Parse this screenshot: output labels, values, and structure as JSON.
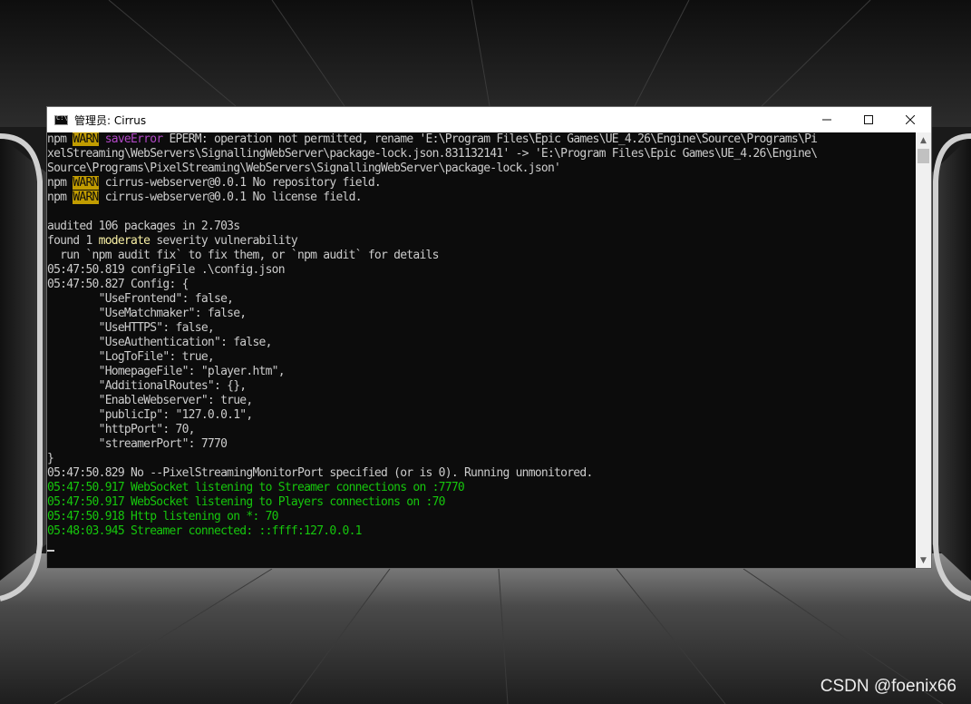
{
  "window": {
    "title": "管理员: Cirrus",
    "icon": "cmd-icon",
    "controls": [
      "minimize-icon",
      "maximize-icon",
      "close-icon"
    ]
  },
  "console": {
    "lines": [
      [
        {
          "t": "npm "
        },
        {
          "t": "WARN",
          "c": "warn"
        },
        {
          "t": " "
        },
        {
          "t": "saveError",
          "c": "purple"
        },
        {
          "t": " EPERM: operation not permitted, rename 'E:\\Program Files\\Epic Games\\UE_4.26\\Engine\\Source\\Programs\\Pi"
        }
      ],
      [
        {
          "t": "xelStreaming\\WebServers\\SignallingWebServer\\package-lock.json.831132141' -> 'E:\\Program Files\\Epic Games\\UE_4.26\\Engine\\"
        }
      ],
      [
        {
          "t": "Source\\Programs\\PixelStreaming\\WebServers\\SignallingWebServer\\package-lock.json'"
        }
      ],
      [
        {
          "t": "npm "
        },
        {
          "t": "WARN",
          "c": "warn"
        },
        {
          "t": " cirrus-webserver@0.0.1 No repository field."
        }
      ],
      [
        {
          "t": "npm "
        },
        {
          "t": "WARN",
          "c": "warn"
        },
        {
          "t": " cirrus-webserver@0.0.1 No license field."
        }
      ],
      [
        {
          "t": ""
        }
      ],
      [
        {
          "t": "audited 106 packages in 2.703s"
        }
      ],
      [
        {
          "t": "found 1 "
        },
        {
          "t": "moderate",
          "c": "yellow"
        },
        {
          "t": " severity vulnerability"
        }
      ],
      [
        {
          "t": "  run `npm audit fix` to fix them, or `npm audit` for details"
        }
      ],
      [
        {
          "t": "05:47:50.819 configFile .\\config.json"
        }
      ],
      [
        {
          "t": "05:47:50.827 Config: {"
        }
      ],
      [
        {
          "t": "        \"UseFrontend\": false,"
        }
      ],
      [
        {
          "t": "        \"UseMatchmaker\": false,"
        }
      ],
      [
        {
          "t": "        \"UseHTTPS\": false,"
        }
      ],
      [
        {
          "t": "        \"UseAuthentication\": false,"
        }
      ],
      [
        {
          "t": "        \"LogToFile\": true,"
        }
      ],
      [
        {
          "t": "        \"HomepageFile\": \"player.htm\","
        }
      ],
      [
        {
          "t": "        \"AdditionalRoutes\": {},"
        }
      ],
      [
        {
          "t": "        \"EnableWebserver\": true,"
        }
      ],
      [
        {
          "t": "        \"publicIp\": \"127.0.0.1\","
        }
      ],
      [
        {
          "t": "        \"httpPort\": 70,"
        }
      ],
      [
        {
          "t": "        \"streamerPort\": 7770"
        }
      ],
      [
        {
          "t": "}"
        }
      ],
      [
        {
          "t": "05:47:50.829 No --PixelStreamingMonitorPort specified (or is 0). Running unmonitored."
        }
      ],
      [
        {
          "t": "05:47:50.917 WebSocket listening to Streamer connections on :7770",
          "c": "green"
        }
      ],
      [
        {
          "t": "05:47:50.917 WebSocket listening to Players connections on :70",
          "c": "green"
        }
      ],
      [
        {
          "t": "05:47:50.918 Http listening on *: 70",
          "c": "green"
        }
      ],
      [
        {
          "t": "05:48:03.945 Streamer connected: ::ffff:127.0.0.1",
          "c": "green"
        }
      ],
      [
        {
          "t": ""
        }
      ]
    ]
  },
  "watermark": "CSDN @foenix66",
  "colors": {
    "console_bg": "#0c0c0c",
    "console_text": "#cccccc",
    "warn_bg": "#c19c00",
    "save_error": "#b148c6",
    "moderate": "#f9f1a5",
    "success": "#16c60c"
  }
}
